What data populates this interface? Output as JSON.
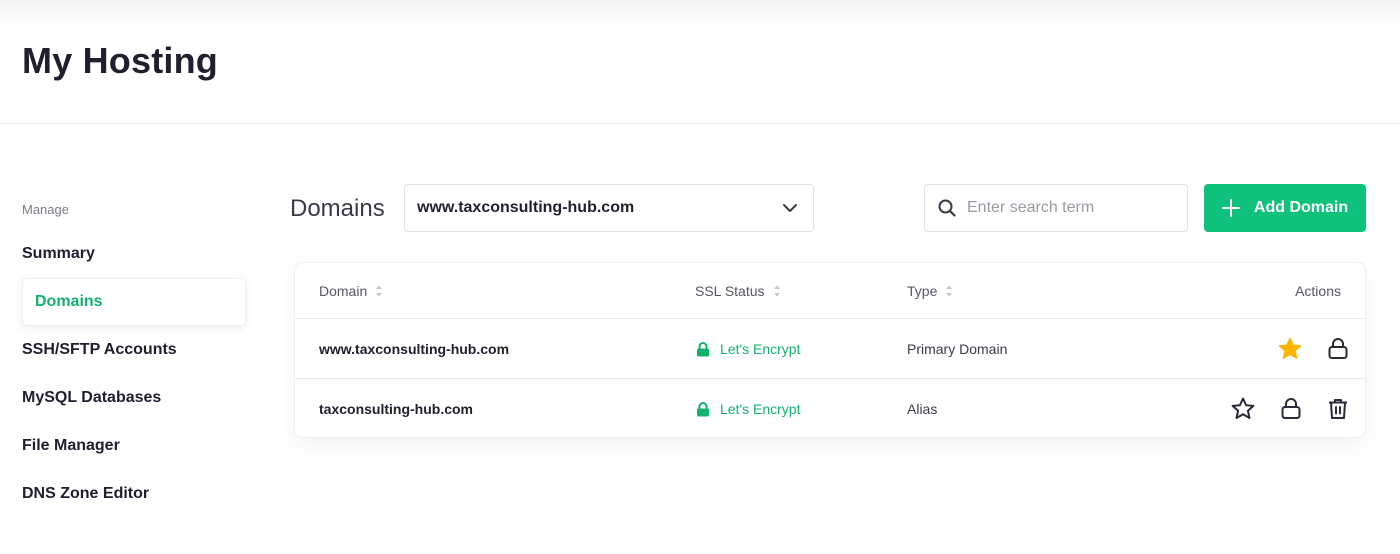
{
  "page": {
    "title": "My Hosting"
  },
  "sidebar": {
    "heading": "Manage",
    "items": [
      {
        "label": "Summary",
        "active": false
      },
      {
        "label": "Domains",
        "active": true
      },
      {
        "label": "SSH/SFTP Accounts",
        "active": false
      },
      {
        "label": "MySQL Databases",
        "active": false
      },
      {
        "label": "File Manager",
        "active": false
      },
      {
        "label": "DNS Zone Editor",
        "active": false
      }
    ]
  },
  "toolbar": {
    "section_label": "Domains",
    "domain_select": {
      "value": "www.taxconsulting-hub.com",
      "icon": "chevron-down-icon"
    },
    "search": {
      "placeholder": "Enter search term",
      "value": "",
      "icon": "search-icon"
    },
    "add_button": {
      "label": "Add Domain",
      "icon": "plus-icon"
    }
  },
  "table": {
    "columns": [
      {
        "label": "Domain",
        "sortable": true
      },
      {
        "label": "SSL Status",
        "sortable": true
      },
      {
        "label": "Type",
        "sortable": true
      },
      {
        "label": "Actions",
        "sortable": false
      }
    ],
    "rows": [
      {
        "domain": "www.taxconsulting-hub.com",
        "ssl": "Let's Encrypt",
        "type": "Primary Domain",
        "actions": [
          "star-filled-icon",
          "lock-icon"
        ]
      },
      {
        "domain": "taxconsulting-hub.com",
        "ssl": "Let's Encrypt",
        "type": "Alias",
        "actions": [
          "star-outline-icon",
          "lock-icon",
          "trash-icon"
        ]
      }
    ]
  },
  "colors": {
    "accent": "#0fc17a",
    "ssl_text": "#12b26e",
    "star": "#ffb400",
    "text": "#1f1f2e"
  }
}
